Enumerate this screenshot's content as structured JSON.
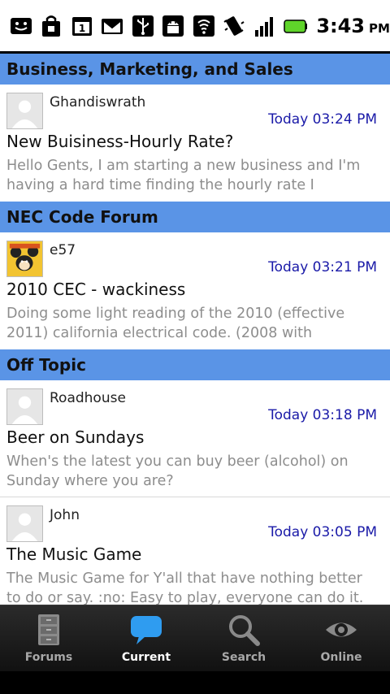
{
  "status_bar": {
    "icons": [
      "face-icon",
      "bag-icon",
      "calendar-icon",
      "gmail-icon",
      "usb-icon",
      "android-icon",
      "wifi-signal-icon",
      "vibrate-icon",
      "cell-signal-icon",
      "battery-icon"
    ],
    "time": "3:43",
    "ampm": "PM",
    "battery_color": "#5fd42a"
  },
  "sections": [
    {
      "header": "Business, Marketing, and Sales",
      "posts": [
        {
          "author": "Ghandiswrath",
          "time": "Today 03:24 PM",
          "title": "New Buisiness-Hourly Rate?",
          "preview": "Hello Gents,   I am starting a new business and I'm having a hard time finding the hourly rate I",
          "avatar": "default-avatar-icon"
        }
      ]
    },
    {
      "header": "NEC Code Forum",
      "posts": [
        {
          "author": "e57",
          "time": "Today 03:21 PM",
          "title": "2010 CEC - wackiness",
          "preview": "Doing some light reading of the 2010 (effective 2011) california electrical code. (2008 with",
          "avatar": "cartoon-mouse-avatar-icon"
        }
      ]
    },
    {
      "header": "Off Topic",
      "posts": [
        {
          "author": "Roadhouse",
          "time": "Today 03:18 PM",
          "title": "Beer on Sundays",
          "preview": "When's the latest you can buy beer (alcohol) on Sunday where you are?",
          "avatar": "default-avatar-icon"
        },
        {
          "author": "John",
          "time": "Today 03:05 PM",
          "title": "The Music Game",
          "preview": "The Music Game for Y'all that have nothing better to do or say. :no:  Easy to play, everyone can do it.",
          "avatar": "default-avatar-icon"
        }
      ]
    }
  ],
  "tabs": [
    {
      "label": "Forums",
      "icon": "cabinet-icon",
      "active": false
    },
    {
      "label": "Current",
      "icon": "speech-bubble-icon",
      "active": true
    },
    {
      "label": "Search",
      "icon": "magnifier-icon",
      "active": false
    },
    {
      "label": "Online",
      "icon": "eye-icon",
      "active": false
    }
  ],
  "colors": {
    "section_header": "#5a94e6",
    "timestamp": "#1a1aa8",
    "preview_text": "#8d8d8d",
    "tab_active_icon": "#2f9cf0"
  }
}
